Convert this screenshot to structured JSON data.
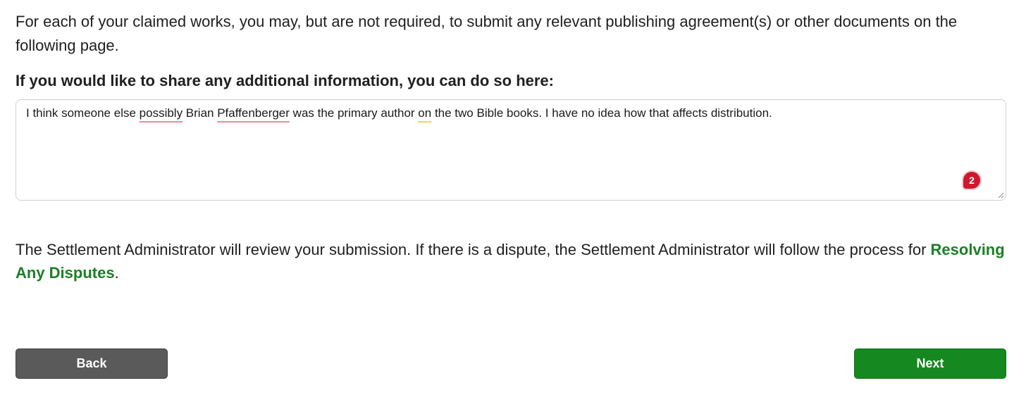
{
  "intro": {
    "text": "For each of your claimed works, you may, but are not required, to submit any relevant publishing agreement(s) or other documents on the following page."
  },
  "additional_info": {
    "label": "If you would like to share any additional information, you can do so here:",
    "value_segments": [
      "I think someone else ",
      "possibly",
      " Brian ",
      "Pfaffenberger",
      " was the primary author ",
      "on",
      " the two Bible books. I have no idea how that affects distribution."
    ],
    "spellcheck_badge": "2"
  },
  "review": {
    "text_before": "The Settlement Administrator will review your submission. If there is a dispute, the Settlement Administrator will follow the process for ",
    "link_label": "Resolving Any Disputes",
    "text_after": "."
  },
  "buttons": {
    "back_label": "Back",
    "next_label": "Next"
  },
  "colors": {
    "link_green": "#1b7f26",
    "next_green": "#15881f",
    "back_gray": "#5a5a5a",
    "badge_red": "#d0172d",
    "spelling_underline": "#ec8a9c",
    "grammar_underline": "#f2d55a"
  }
}
